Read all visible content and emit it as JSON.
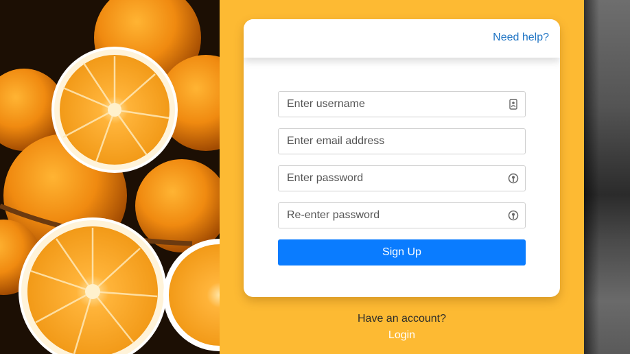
{
  "page": {
    "accent_color": "#fdba33",
    "primary_button_color": "#0a7cff",
    "link_color": "#1f74c4"
  },
  "card": {
    "help_link": "Need help?"
  },
  "form": {
    "username": {
      "value": "",
      "placeholder": "Enter username",
      "icon": "contact-card-icon"
    },
    "email": {
      "value": "",
      "placeholder": "Enter email address"
    },
    "password": {
      "value": "",
      "placeholder": "Enter password",
      "icon": "password-key-icon"
    },
    "confirm_password": {
      "value": "",
      "placeholder": "Re-enter password",
      "icon": "password-key-icon"
    },
    "submit_label": "Sign Up"
  },
  "footer": {
    "prompt": "Have an account?",
    "login_label": "Login"
  }
}
